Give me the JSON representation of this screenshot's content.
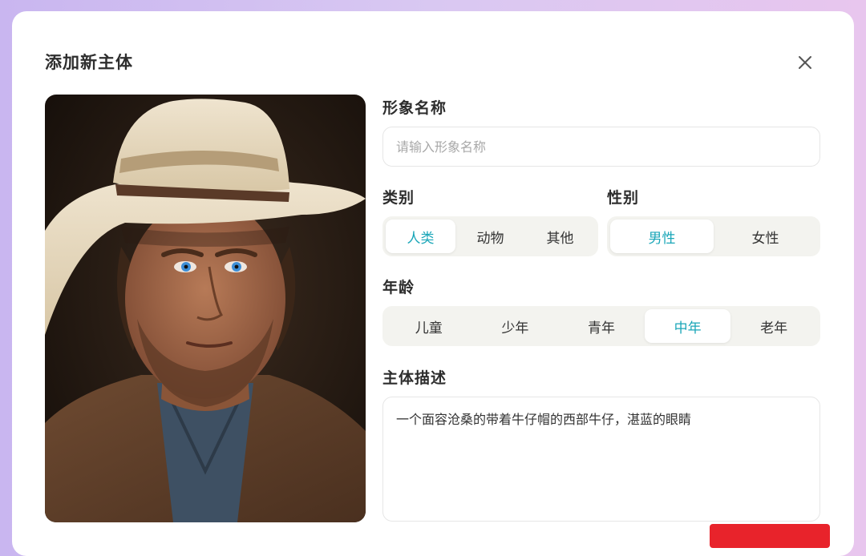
{
  "dialog": {
    "title": "添加新主体",
    "close_icon": "close-icon"
  },
  "photo": {
    "subject": "cowboy portrait"
  },
  "name_field": {
    "label": "形象名称",
    "placeholder": "请输入形象名称",
    "value": ""
  },
  "category": {
    "label": "类别",
    "options": [
      "人类",
      "动物",
      "其他"
    ],
    "selected": "人类"
  },
  "gender": {
    "label": "性别",
    "options": [
      "男性",
      "女性"
    ],
    "selected": "男性"
  },
  "age": {
    "label": "年龄",
    "options": [
      "儿童",
      "少年",
      "青年",
      "中年",
      "老年"
    ],
    "selected": "中年"
  },
  "description": {
    "label": "主体描述",
    "value": "一个面容沧桑的带着牛仔帽的西部牛仔，湛蓝的眼睛"
  },
  "colors": {
    "accent": "#1aa6b8",
    "confirm": "#e8232b",
    "segment_bg": "#f3f3ef"
  }
}
